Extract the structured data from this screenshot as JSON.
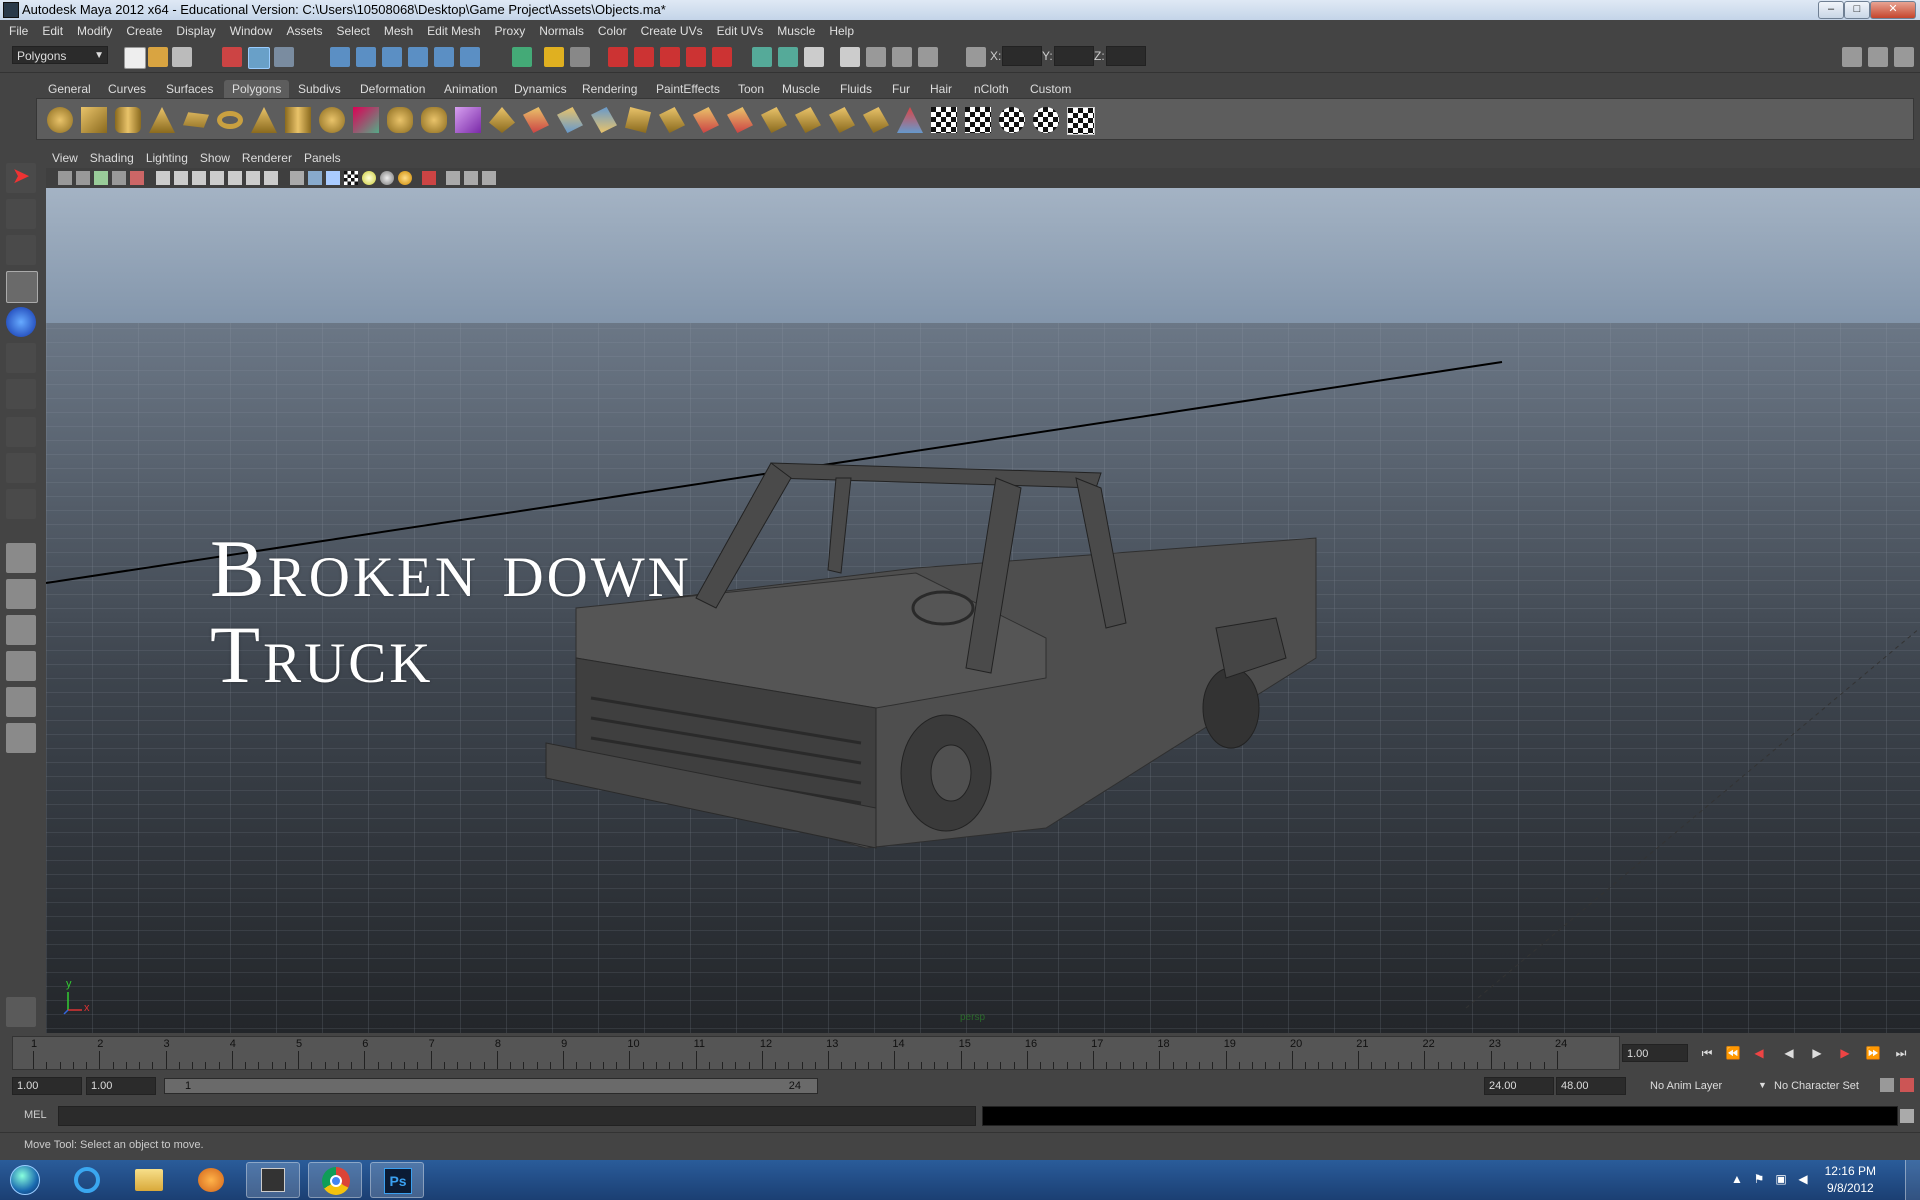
{
  "window": {
    "title": "Autodesk Maya 2012 x64 - Educational Version: C:\\Users\\10508068\\Desktop\\Game Project\\Assets\\Objects.ma*",
    "minimize": "–",
    "maximize": "□",
    "close": "✕"
  },
  "menu": [
    "File",
    "Edit",
    "Modify",
    "Create",
    "Display",
    "Window",
    "Assets",
    "Select",
    "Mesh",
    "Edit Mesh",
    "Proxy",
    "Normals",
    "Color",
    "Create UVs",
    "Edit UVs",
    "Muscle",
    "Help"
  ],
  "statusline": {
    "menuset": "Polygons",
    "x_label": "X:",
    "y_label": "Y:",
    "z_label": "Z:"
  },
  "shelf": {
    "tabs": [
      "General",
      "Curves",
      "Surfaces",
      "Polygons",
      "Subdivs",
      "Deformation",
      "Animation",
      "Dynamics",
      "Rendering",
      "PaintEffects",
      "Toon",
      "Muscle",
      "Fluids",
      "Fur",
      "Hair",
      "nCloth",
      "Custom"
    ],
    "active_tab": "Polygons"
  },
  "viewport": {
    "menu": [
      "View",
      "Shading",
      "Lighting",
      "Show",
      "Renderer",
      "Panels"
    ],
    "overlay_line1": "Broken down",
    "overlay_line2": "Truck",
    "camera_label": "persp",
    "axis_y": "y",
    "axis_x": "x"
  },
  "timeslider": {
    "ticks": [
      "1",
      "2",
      "3",
      "4",
      "5",
      "6",
      "7",
      "8",
      "9",
      "10",
      "11",
      "12",
      "13",
      "14",
      "15",
      "16",
      "17",
      "18",
      "19",
      "20",
      "21",
      "22",
      "23",
      "24"
    ],
    "current_frame": "1.00"
  },
  "range": {
    "start": "1.00",
    "playback_start": "1.00",
    "bar_start": "1",
    "bar_end": "24",
    "playback_end": "24.00",
    "end": "48.00",
    "anim_layer": "No Anim Layer",
    "character_set": "No Character Set"
  },
  "commandline": {
    "label": "MEL"
  },
  "helpline": "Move Tool: Select an object to move.",
  "taskbar": {
    "time": "12:16 PM",
    "date": "9/8/2012",
    "ps_label": "Ps"
  }
}
